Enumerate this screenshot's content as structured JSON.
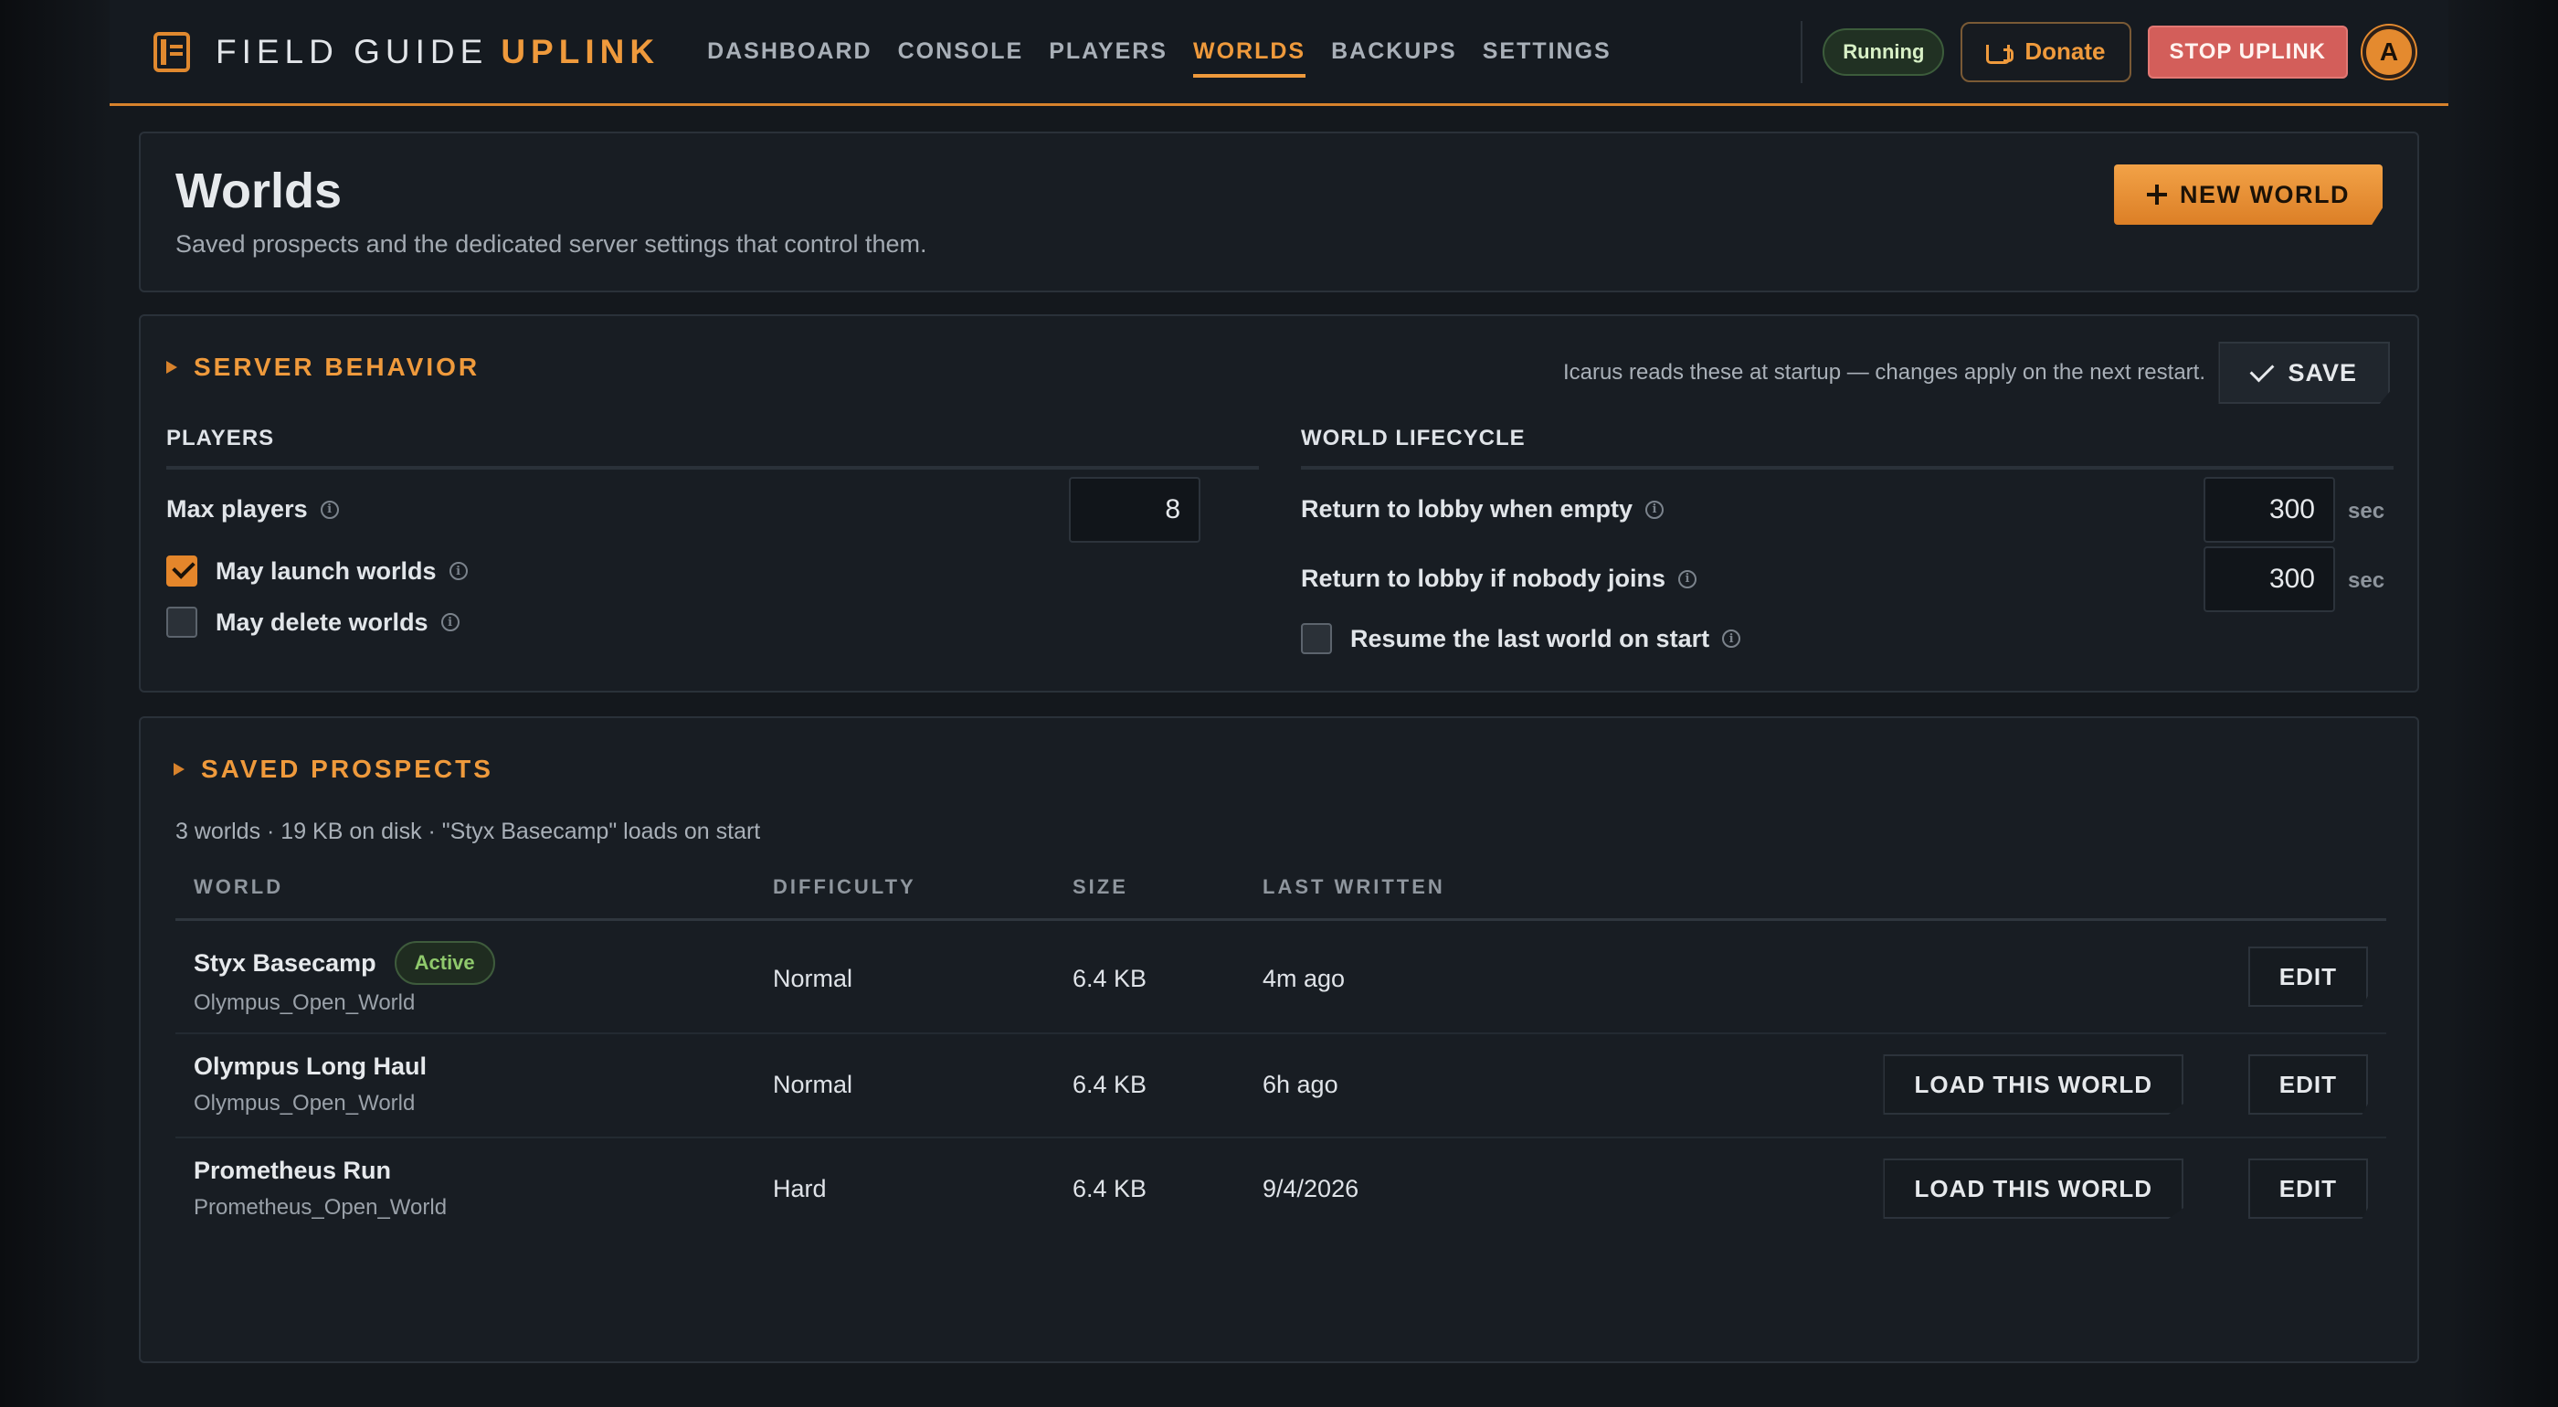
{
  "brand": {
    "name": "FIELD GUIDE",
    "accent": "UPLINK",
    "icon": "book-icon"
  },
  "nav": {
    "items": [
      {
        "label": "DASHBOARD"
      },
      {
        "label": "CONSOLE"
      },
      {
        "label": "PLAYERS"
      },
      {
        "label": "WORLDS",
        "active": true
      },
      {
        "label": "BACKUPS"
      },
      {
        "label": "SETTINGS"
      }
    ]
  },
  "topbar": {
    "status": "Running",
    "donate_label": "Donate",
    "stop_label": "STOP UPLINK",
    "avatar_initial": "A"
  },
  "header": {
    "title": "Worlds",
    "subtitle": "Saved prospects and the dedicated server settings that control them.",
    "new_world_label": "NEW WORLD"
  },
  "behavior": {
    "section_title": "SERVER BEHAVIOR",
    "note": "Icarus reads these at startup — changes apply on the next restart.",
    "save_label": "SAVE",
    "players": {
      "heading": "PLAYERS",
      "max_players_label": "Max players",
      "max_players_value": "8",
      "may_launch_label": "May launch worlds",
      "may_launch_checked": true,
      "may_delete_label": "May delete worlds",
      "may_delete_checked": false
    },
    "lifecycle": {
      "heading": "WORLD LIFECYCLE",
      "empty_label": "Return to lobby when empty",
      "empty_value": "300",
      "nobody_label": "Return to lobby if nobody joins",
      "nobody_value": "300",
      "unit": "sec",
      "resume_label": "Resume the last world on start",
      "resume_checked": false
    }
  },
  "prospects": {
    "section_title": "SAVED PROSPECTS",
    "summary": "3 worlds · 19 KB on disk · \"Styx Basecamp\" loads on start",
    "columns": [
      "WORLD",
      "DIFFICULTY",
      "SIZE",
      "LAST WRITTEN"
    ],
    "load_label": "LOAD THIS WORLD",
    "edit_label": "EDIT",
    "active_label": "Active",
    "rows": [
      {
        "name": "Styx Basecamp",
        "map": "Olympus_Open_World",
        "difficulty": "Normal",
        "size": "6.4 KB",
        "written": "4m ago",
        "active": true
      },
      {
        "name": "Olympus Long Haul",
        "map": "Olympus_Open_World",
        "difficulty": "Normal",
        "size": "6.4 KB",
        "written": "6h ago",
        "active": false
      },
      {
        "name": "Prometheus Run",
        "map": "Prometheus_Open_World",
        "difficulty": "Hard",
        "size": "6.4 KB",
        "written": "9/4/2026",
        "active": false
      }
    ]
  },
  "colors": {
    "accent": "#ef9a3c",
    "danger": "#d35e5a",
    "success": "#8fc96c"
  }
}
